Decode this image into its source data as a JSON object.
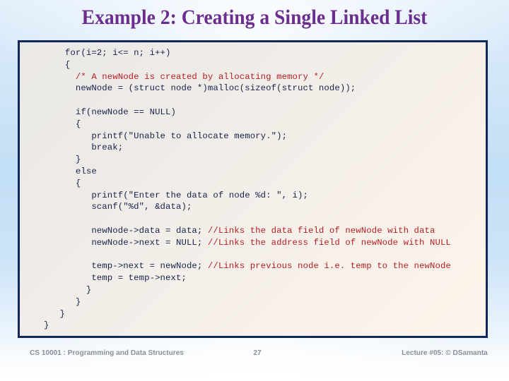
{
  "slide": {
    "title": "Example 2: Creating a Single Linked List",
    "title_color": "#6b2d8e",
    "background_top_color": "#e4f0fb",
    "background_mid_color": "#c3dff6",
    "background_bottom_color": "#ffffff"
  },
  "code_block": {
    "border_color": "#12275c",
    "background_color": "#f2eee9",
    "code_color": "#17224d",
    "comment_color": "#b41f24",
    "lines": [
      "    for(i=2; i<= n; i++)",
      "    {",
      "      <cm>/* A newNode is created by allocating memory */</cm>",
      "      newNode = (struct node *)malloc(sizeof(struct node));",
      "",
      "      if(newNode == NULL)",
      "      {",
      "         printf(\"Unable to allocate memory.\");",
      "         break;",
      "      }",
      "      else",
      "      {",
      "         printf(\"Enter the data of node %d: \", i);",
      "         scanf(\"%d\", &data);",
      "",
      "         newNode->data = data; <cm>//Links the data field of newNode with data</cm>",
      "         newNode->next = NULL; <cm>//Links the address field of newNode with NULL</cm>",
      "",
      "         temp->next = newNode; <cm>//Links previous node i.e. temp to the newNode</cm>",
      "         temp = temp->next;",
      "        }",
      "      }",
      "   }",
      "}"
    ],
    "plain_text": "    for(i=2; i<= n; i++)\n    {\n      /* A newNode is created by allocating memory */\n      newNode = (struct node *)malloc(sizeof(struct node));\n\n      if(newNode == NULL)\n      {\n         printf(\"Unable to allocate memory.\");\n         break;\n      }\n      else\n      {\n         printf(\"Enter the data of node %d: \", i);\n         scanf(\"%d\", &data);\n\n         newNode->data = data; //Links the data field of newNode with data\n         newNode->next = NULL; //Links the address field of newNode with NULL\n\n         temp->next = newNode; //Links previous node i.e. temp to the newNode\n         temp = temp->next;\n        }\n      }\n   }\n}"
  },
  "footer": {
    "left": "CS 10001 : Programming and Data Structures",
    "page_number": "27",
    "right": "Lecture #05: © DSamanta",
    "text_color": "#8a9099"
  }
}
